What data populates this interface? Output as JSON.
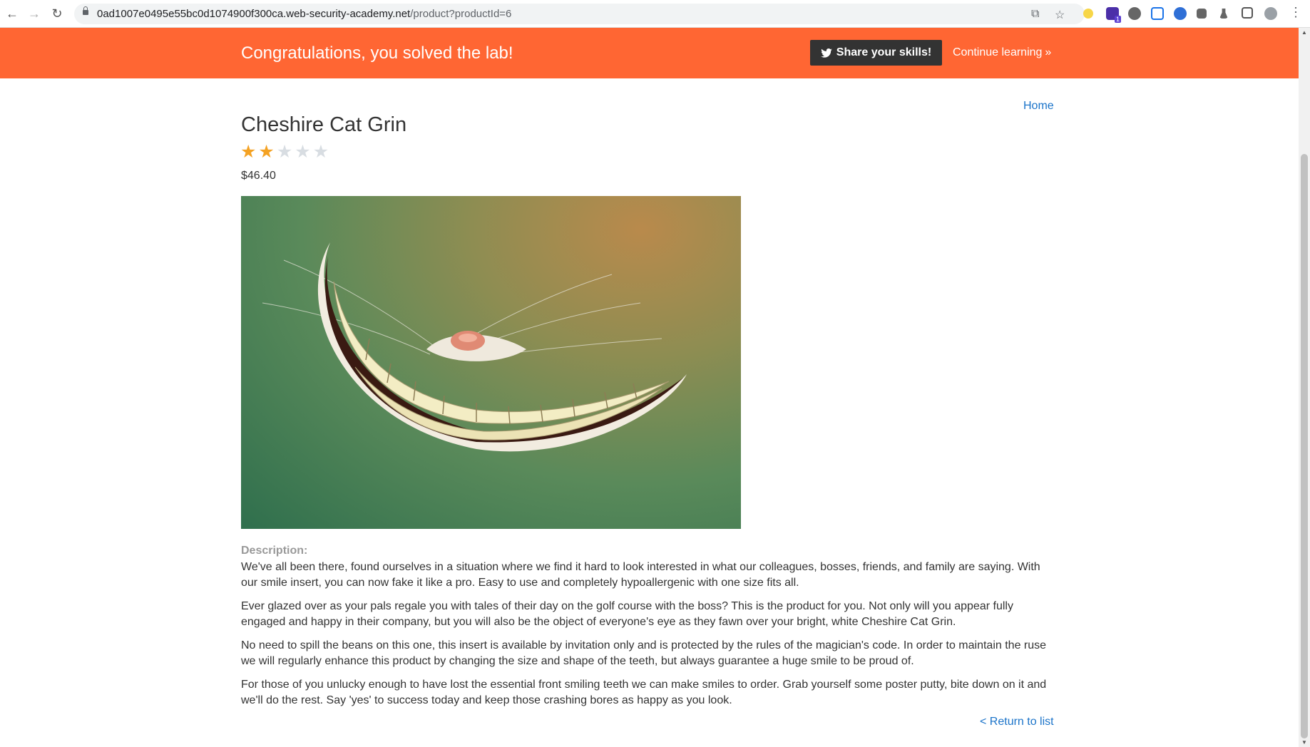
{
  "browser": {
    "url_host": "0ad1007e0495e55bc0d1074900f300ca.web-security-academy.net",
    "url_path": "/product?productId=6",
    "extension_badge": "1"
  },
  "banner": {
    "title": "Congratulations, you solved the lab!",
    "share_label": "Share your skills!",
    "continue_label": "Continue learning",
    "chevron": "»",
    "color": "#ff6633"
  },
  "nav": {
    "home_label": "Home"
  },
  "product": {
    "title": "Cheshire Cat Grin",
    "rating": 2,
    "rating_max": 5,
    "price": "$46.40",
    "image_icon": "cheshire-cat-grin-image",
    "description_label": "Description:",
    "description": [
      "We've all been there, found ourselves in a situation where we find it hard to look interested in what our colleagues, bosses, friends, and family are saying. With our smile insert, you can now fake it like a pro. Easy to use and completely hypoallergenic with one size fits all.",
      "Ever glazed over as your pals regale you with tales of their day on the golf course with the boss? This is the product for you. Not only will you appear fully engaged and happy in their company, but you will also be the object of everyone's eye as they fawn over your bright, white Cheshire Cat Grin.",
      "No need to spill the beans on this one, this insert is available by invitation only and is protected by the rules of the magician's code. In order to maintain the ruse we will regularly enhance this product by changing the size and shape of the teeth, but always guarantee a huge smile to be proud of.",
      "For those of you unlucky enough to have lost the essential front smiling teeth we can make smiles to order. Grab yourself some poster putty, bite down on it and we'll do the rest. Say 'yes' to success today and keep those crashing bores as happy as you look."
    ]
  },
  "footer": {
    "return_label": "< Return to list"
  },
  "colors": {
    "link": "#1a73c9",
    "star_on": "#f4a223",
    "star_off": "#d8dde2"
  }
}
